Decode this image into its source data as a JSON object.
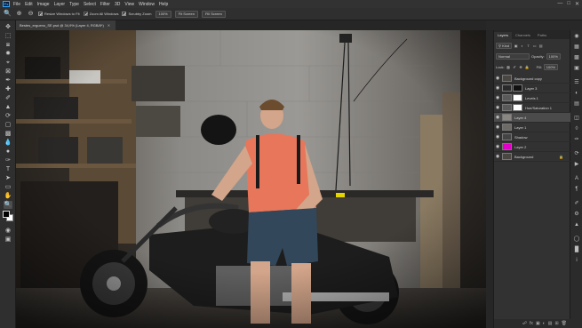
{
  "app": {
    "logo": "Ps"
  },
  "menu": [
    "File",
    "Edit",
    "Image",
    "Layer",
    "Type",
    "Select",
    "Filter",
    "3D",
    "View",
    "Window",
    "Help"
  ],
  "window_controls": {
    "minimize": "—",
    "maximize": "□",
    "close": "✕"
  },
  "options_bar": {
    "resize_windows_label": "Resize Windows to Fit",
    "zoom_all_windows_label": "Zoom All Windows",
    "scrubby_zoom_label": "Scrubby Zoom",
    "zoom_percent": "100%",
    "fit_screen_label": "Fit Screen",
    "fill_screen_label": "Fill Screen"
  },
  "document": {
    "tab_title": "Bestes_ergueno_SE.psd @ 34,9% (Layer 4, RGB/8*)"
  },
  "layers_panel": {
    "tabs": [
      "Layers",
      "Channels",
      "Paths"
    ],
    "kind_label": "Kind",
    "blend_mode": "Normal",
    "opacity_label": "Opacity:",
    "opacity_value": "100%",
    "lock_label": "Lock:",
    "fill_label": "Fill:",
    "fill_value": "100%",
    "layers": [
      {
        "name": "Background copy",
        "thumb": "#4a4642",
        "mask": false,
        "selected": false
      },
      {
        "name": "Layer 3",
        "thumb": "#2a2a2a",
        "mask": true,
        "selected": false
      },
      {
        "name": "Levels 1",
        "thumb": "#5a5a5a",
        "mask": true,
        "selected": false
      },
      {
        "name": "Hue/Saturation 1",
        "thumb": "#5a5a5a",
        "mask": true,
        "selected": false
      },
      {
        "name": "Layer 4",
        "thumb": "#8a8682",
        "mask": false,
        "selected": true
      },
      {
        "name": "Layer 1",
        "thumb": "#6e6a66",
        "mask": false,
        "selected": false
      },
      {
        "name": "Shadow",
        "thumb": "#444444",
        "mask": false,
        "selected": false
      },
      {
        "name": "Layer 2",
        "thumb": "#e000c8",
        "mask": false,
        "selected": false
      },
      {
        "name": "Background",
        "thumb": "#4a4642",
        "mask": false,
        "selected": false,
        "locked": true
      }
    ]
  },
  "colors": {
    "accent": "#31a8ff",
    "shirt": "#e8765a",
    "magenta_layer": "#e000c8"
  }
}
